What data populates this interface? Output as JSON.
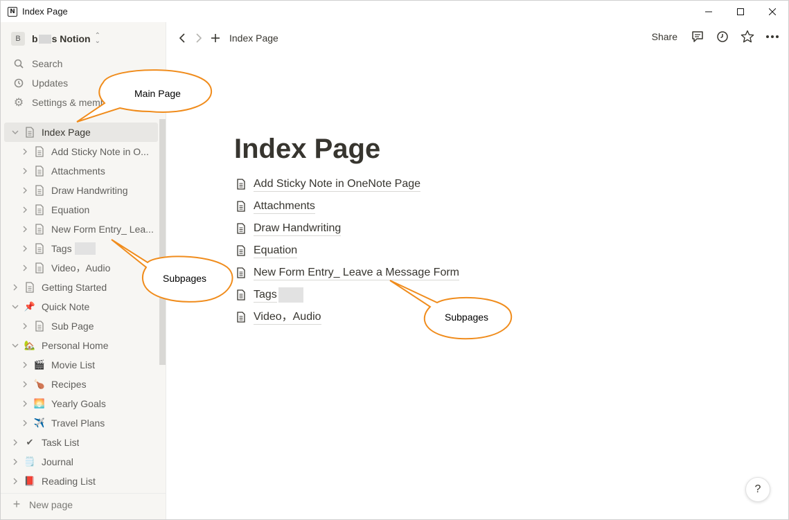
{
  "window": {
    "title": "Index Page",
    "app_icon": "N"
  },
  "workspace": {
    "avatar": "B",
    "name_prefix": "b",
    "name_suffix": "s Notion"
  },
  "quick": [
    {
      "label": "Search",
      "icon": "search-icon"
    },
    {
      "label": "Updates",
      "icon": "clock-icon"
    },
    {
      "label": "Settings & members",
      "icon": "gear-icon"
    }
  ],
  "tree": [
    {
      "label": "Index Page",
      "icon": "doc",
      "level": 0,
      "open": true,
      "active": true
    },
    {
      "label": "Add Sticky Note in O...",
      "icon": "doc",
      "level": 1
    },
    {
      "label": "Attachments",
      "icon": "doc",
      "level": 1
    },
    {
      "label": "Draw Handwriting",
      "icon": "doc",
      "level": 1
    },
    {
      "label": "Equation",
      "icon": "doc",
      "level": 1
    },
    {
      "label": "New Form Entry_ Lea...",
      "icon": "doc",
      "level": 1
    },
    {
      "label": "Tags",
      "icon": "doc",
      "level": 1,
      "blur": true
    },
    {
      "label": "Video，Audio",
      "icon": "doc",
      "level": 1
    },
    {
      "label": "Getting Started",
      "icon": "doc",
      "level": 0
    },
    {
      "label": "Quick Note",
      "icon": "📌",
      "level": 0,
      "open": true
    },
    {
      "label": "Sub Page",
      "icon": "doc",
      "level": 1
    },
    {
      "label": "Personal Home",
      "icon": "🏡",
      "level": 0,
      "open": true
    },
    {
      "label": "Movie List",
      "icon": "🎬",
      "level": 1
    },
    {
      "label": "Recipes",
      "icon": "🍗",
      "level": 1
    },
    {
      "label": "Yearly Goals",
      "icon": "🌅",
      "level": 1
    },
    {
      "label": "Travel Plans",
      "icon": "✈️",
      "level": 1
    },
    {
      "label": "Task List",
      "icon": "✔",
      "level": 0
    },
    {
      "label": "Journal",
      "icon": "🗒️",
      "level": 0
    },
    {
      "label": "Reading List",
      "icon": "📕",
      "level": 0
    }
  ],
  "new_page_label": "New page",
  "topbar": {
    "breadcrumb": "Index Page",
    "share_label": "Share"
  },
  "page": {
    "title": "Index Page",
    "links": [
      "Add Sticky Note in OneNote Page",
      "Attachments",
      "Draw Handwriting",
      "Equation",
      "New Form Entry_ Leave a Message Form",
      "Tags",
      "Video，Audio"
    ]
  },
  "help_label": "?",
  "callouts": {
    "main_page": "Main Page",
    "subpages_sidebar": "Subpages",
    "subpages_content": "Subpages"
  },
  "colors": {
    "sidebar_bg": "#f7f6f3",
    "callout_stroke": "#f08c1c",
    "text": "#37352f"
  }
}
